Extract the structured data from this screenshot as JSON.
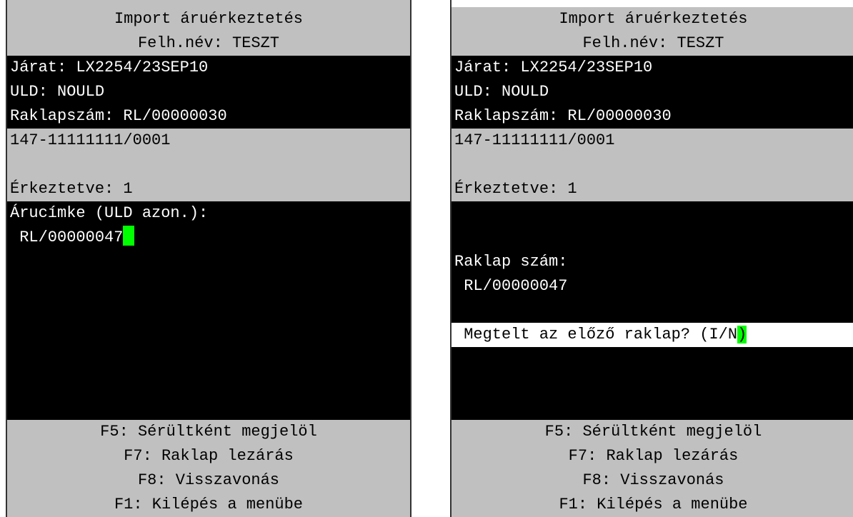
{
  "left": {
    "header": {
      "title": "Import áruérkeztetés",
      "user": "Felh.név: TESZT"
    },
    "info": {
      "flight": "Járat: LX2254/23SEP10",
      "uld": "ULD: NOULD",
      "pallet": "Raklapszám: RL/00000030"
    },
    "awb": {
      "number": "147-11111111/0001",
      "blank": "",
      "arrived": "Érkeztetve: 1"
    },
    "input": {
      "label": "Árucímke (ULD azon.):",
      "value": " RL/00000047"
    },
    "footer": [
      "F5: Sérültként megjelöl",
      "F7: Raklap lezárás",
      "F8: Visszavonás",
      "F1: Kilépés a menübe"
    ]
  },
  "right": {
    "header": {
      "title": "Import áruérkeztetés",
      "user": "Felh.név: TESZT"
    },
    "info": {
      "flight": "Járat: LX2254/23SEP10",
      "uld": "ULD: NOULD",
      "pallet": "Raklapszám: RL/00000030"
    },
    "awb": {
      "number": "147-11111111/0001",
      "blank": "",
      "arrived": "Érkeztetve: 1"
    },
    "pallet_block": {
      "label": "Raklap szám:",
      "value": " RL/00000047"
    },
    "prompt": {
      "text": " Megtelt az előző raklap? (I/N",
      "cursor_char": ")"
    },
    "footer": [
      "F5: Sérültként megjelöl",
      "F7: Raklap lezárás",
      "F8: Visszavonás",
      "F1: Kilépés a menübe"
    ]
  },
  "colors": {
    "terminal_bg": "#000000",
    "band_gray": "#c0c0c0",
    "cursor": "#00ff00"
  }
}
